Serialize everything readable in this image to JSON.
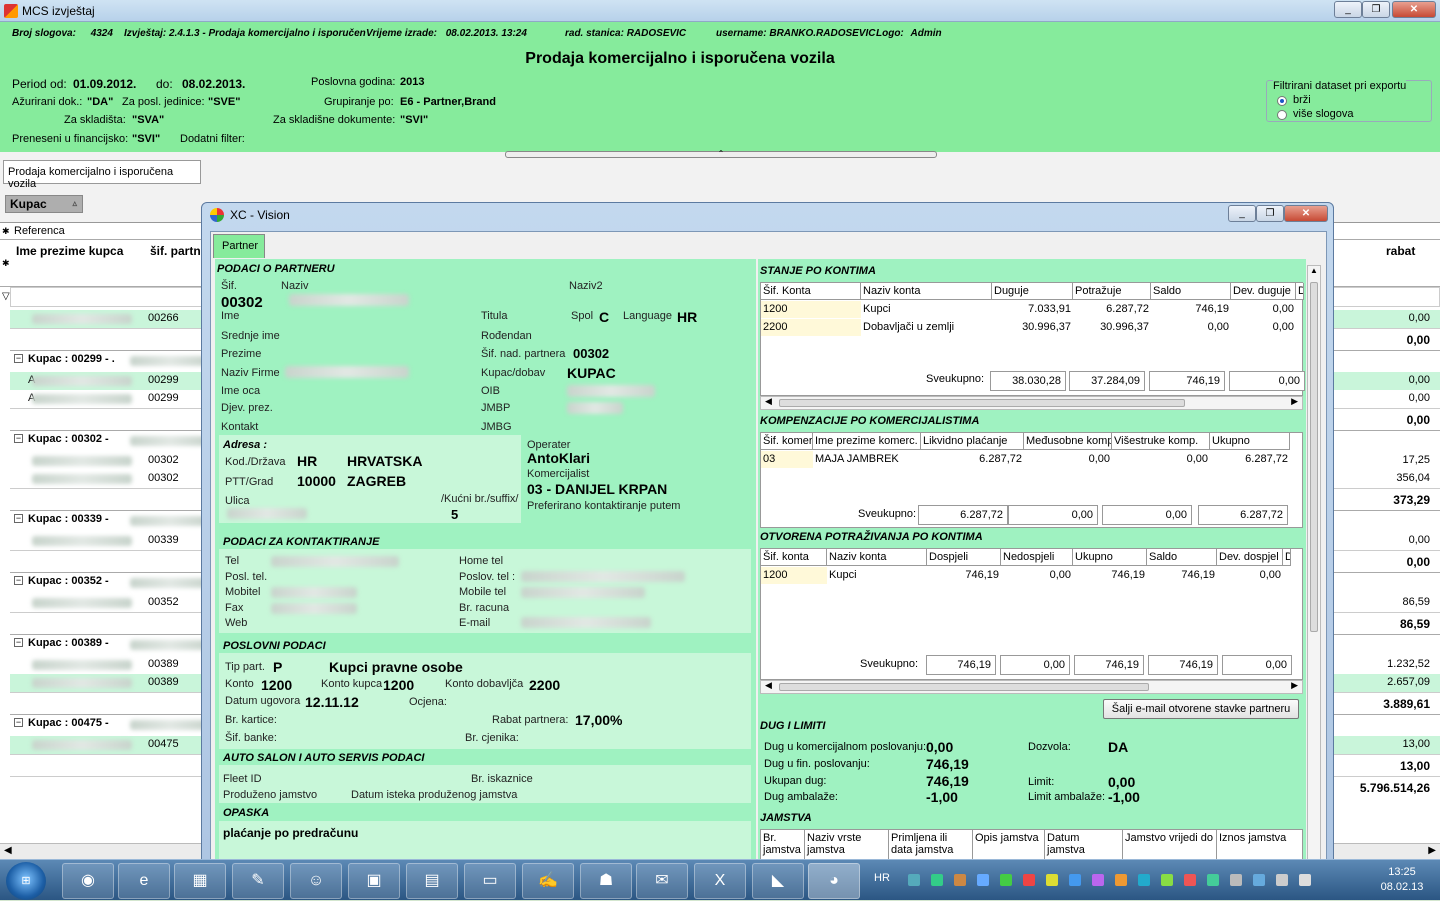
{
  "window": {
    "title": "MCS izvještaj"
  },
  "header": {
    "broj_slogova_label": "Broj slogova:",
    "broj_slogova": "4324",
    "izvjestaj_label": "Izvještaj:",
    "izvjestaj": "2.4.1.3 - Prodaja komercijalno i isporučen",
    "vrijeme_label": "Vrijeme izrade:",
    "vrijeme": "08.02.2013. 13:24",
    "stanica_label": "rad. stanica:",
    "stanica": "RADOSEVIC",
    "username_label": "username:",
    "username": "BRANKO.RADOSEVIC",
    "logo_label": "Logo:",
    "logo": "Admin",
    "report_title": "Prodaja komercijalno i isporučena vozila",
    "period_od_label": "Period od:",
    "period_od": "01.09.2012.",
    "period_do_label": "do:",
    "period_do": "08.02.2013.",
    "azurirani_label": "Ažurirani dok.:",
    "azurirani": "\"DA\"",
    "posl_jed_label": "Za posl. jedinice:",
    "posl_jed": "\"SVE\"",
    "skladista_label": "Za skladišta:",
    "skladista": "\"SVA\"",
    "preneseni_label": "Preneseni u financijsko:",
    "preneseni": "\"SVI\"",
    "dodatni_label": "Dodatni filter:",
    "godina_label": "Poslovna godina:",
    "godina": "2013",
    "grupiranje_label": "Grupiranje po:",
    "grupiranje": "E6 - Partner,Brand",
    "skl_dok_label": "Za skladišne dokumente:",
    "skl_dok": "\"SVI\"",
    "filter": {
      "legend": "Filtrirani dataset pri exportu",
      "opt1": "brži",
      "opt2": "više slogova"
    }
  },
  "report_tab": "Prodaja komercijalno i isporučena vozila",
  "group_chip": "Kupac",
  "grid": {
    "referenca": "Referenca",
    "col_ime": "Ime prezime kupca",
    "col_sif": "šif. partn",
    "col_rabat": "rabat",
    "rows": [
      {
        "type": "d",
        "sif": "00266",
        "rabat": "0,00"
      },
      {
        "type": "t",
        "rabat": "0,00"
      },
      {
        "type": "g",
        "label": "Kupac : 00299 - ."
      },
      {
        "type": "d",
        "pre": "A",
        "sif": "00299",
        "rabat": "0,00"
      },
      {
        "type": "d",
        "pre": "A",
        "sif": "00299",
        "rabat": "0,00"
      },
      {
        "type": "t",
        "rabat": "0,00"
      },
      {
        "type": "g",
        "label": "Kupac : 00302 -"
      },
      {
        "type": "d",
        "sif": "00302",
        "rabat": "17,25"
      },
      {
        "type": "d",
        "sif": "00302",
        "rabat": "356,04"
      },
      {
        "type": "t",
        "rabat": "373,29"
      },
      {
        "type": "g",
        "label": "Kupac : 00339 -"
      },
      {
        "type": "d",
        "sif": "00339",
        "rabat": "0,00"
      },
      {
        "type": "t",
        "rabat": "0,00"
      },
      {
        "type": "g",
        "label": "Kupac : 00352 -"
      },
      {
        "type": "d",
        "sif": "00352",
        "rabat": "86,59"
      },
      {
        "type": "t",
        "rabat": "86,59"
      },
      {
        "type": "g",
        "label": "Kupac : 00389 -"
      },
      {
        "type": "d",
        "sif": "00389",
        "rabat": "1.232,52"
      },
      {
        "type": "d",
        "sif": "00389",
        "rabat": "2.657,09"
      },
      {
        "type": "t",
        "rabat": "3.889,61"
      },
      {
        "type": "g",
        "label": "Kupac : 00475 -"
      },
      {
        "type": "d",
        "sif": "00475",
        "rabat": "13,00"
      },
      {
        "type": "t",
        "rabat": "13,00"
      },
      {
        "type": "t",
        "rabat": "5.796.514,26"
      }
    ]
  },
  "dialog": {
    "title": "XC - Vision",
    "tab": "Partner",
    "podaci": {
      "title": "PODACI O PARTNERU",
      "sif_label": "Šif.",
      "sif": "00302",
      "naziv_label": "Naziv",
      "naziv2_label": "Naziv2",
      "ime": "Ime",
      "titula": "Titula",
      "spol_label": "Spol",
      "spol": "C",
      "language_label": "Language",
      "language": "HR",
      "srednje": "Srednje ime",
      "rodendan": "Rođendan",
      "prezime": "Prezime",
      "sif_nad_label": "Šif. nad. partnera",
      "sif_nad": "00302",
      "naziv_firme": "Naziv Firme",
      "kupac_dobav_label": "Kupac/dobav",
      "kupac_dobav": "KUPAC",
      "ime_oca": "Ime oca",
      "oib": "OIB",
      "djev": "Djev. prez.",
      "jmbp": "JMBP",
      "kontakt": "Kontakt",
      "jmbg": "JMBG"
    },
    "adresa": {
      "title": "Adresa :",
      "kod_label": "Kod./Država",
      "kod": "HR",
      "drzava": "HRVATSKA",
      "ptt_label": "PTT/Grad",
      "ptt": "10000",
      "grad": "ZAGREB",
      "ulica": "Ulica",
      "kucni_label": "/Kućni br./suffix/",
      "kucni": "5",
      "operater_label": "Operater",
      "operater": "AntoKlari",
      "komercijalist_label": "Komercijalist",
      "komercijalist": "03 - DANIJEL KRPAN",
      "pref": "Preferirano kontaktiranje putem"
    },
    "kontakt": {
      "title": "PODACI ZA KONTAKTIRANJE",
      "tel": "Tel",
      "posl": "Posl. tel.",
      "mob": "Mobitel",
      "fax": "Fax",
      "web": "Web",
      "home": "Home tel",
      "poslov": "Poslov. tel :",
      "mobile": "Mobile tel",
      "racun": "Br. racuna",
      "email": "E-mail"
    },
    "poslovni": {
      "title": "POSLOVNI PODACI",
      "tip_label": "Tip part.",
      "tip": "P",
      "tip_naziv": "Kupci pravne osobe",
      "konto_label": "Konto",
      "konto": "1200",
      "konto_kupca_label": "Konto kupca",
      "konto_kupca": "1200",
      "konto_dob_label": "Konto dobavljča",
      "konto_dob": "2200",
      "datum_label": "Datum ugovora",
      "datum": "12.11.12",
      "ocjena": "Ocjena:",
      "kartice": "Br. kartice:",
      "rabat_label": "Rabat partnera:",
      "rabat": "17,00%",
      "banke": "Šif. banke:",
      "cjenika": "Br. cjenika:"
    },
    "auto": {
      "title": "AUTO SALON I AUTO SERVIS PODACI",
      "fleet": "Fleet ID",
      "iskaznice": "Br. iskaznice",
      "produzeno": "Produženo jamstvo",
      "datum_isteka": "Datum isteka produženog jamstva"
    },
    "opaska": {
      "title": "OPASKA",
      "text": "plaćanje po predračunu"
    },
    "stanje": {
      "title": "STANJE PO KONTIMA",
      "cols": [
        "Šif. Konta",
        "Naziv konta",
        "Duguje",
        "Potražuje",
        "Saldo",
        "Dev. duguje",
        "D"
      ],
      "rows": [
        [
          "1200",
          "Kupci",
          "7.033,91",
          "6.287,72",
          "746,19",
          "0,00"
        ],
        [
          "2200",
          "Dobavljači u zemlji",
          "30.996,37",
          "30.996,37",
          "0,00",
          "0,00"
        ]
      ],
      "sv_label": "Sveukupno:",
      "sv": [
        "38.030,28",
        "37.284,09",
        "746,19",
        "0,00"
      ]
    },
    "komp": {
      "title": "KOMPENZACIJE PO KOMERCIJALISTIMA",
      "cols": [
        "Šif. komer",
        "Ime prezime komerc.",
        "Likvidno plaćanje",
        "Međusobne komp.",
        "Višestruke komp.",
        "Ukupno"
      ],
      "rows": [
        [
          "03",
          "MAJA JAMBREK",
          "6.287,72",
          "0,00",
          "0,00",
          "6.287,72"
        ]
      ],
      "sv_label": "Sveukupno:",
      "sv": [
        "6.287,72",
        "0,00",
        "0,00",
        "6.287,72"
      ]
    },
    "otv": {
      "title": "OTVORENA POTRAŽIVANJA PO KONTIMA",
      "cols": [
        "Šif. konta",
        "Naziv konta",
        "Dospjeli",
        "Nedospjeli",
        "Ukupno",
        "Saldo",
        "Dev. dospjel",
        "D"
      ],
      "rows": [
        [
          "1200",
          "Kupci",
          "746,19",
          "0,00",
          "746,19",
          "746,19",
          "0,00"
        ]
      ],
      "sv_label": "Sveukupno:",
      "sv": [
        "746,19",
        "0,00",
        "746,19",
        "746,19",
        "0,00"
      ],
      "button": "Šalji e-mail otvorene stavke partneru"
    },
    "dug": {
      "title": "DUG I LIMITI",
      "kom_label": "Dug u komercijalnom poslovanju:",
      "kom": "0,00",
      "fin_label": "Dug u fin. poslovanju:",
      "fin": "746,19",
      "ukupan_label": "Ukupan dug:",
      "ukupan": "746,19",
      "amb_label": "Dug ambalaže:",
      "amb": "-1,00",
      "dozvola_label": "Dozvola:",
      "dozvola": "DA",
      "limit_label": "Limit:",
      "limit": "0,00",
      "limit_amb_label": "Limit ambalaže:",
      "limit_amb": "-1,00"
    },
    "jamstva": {
      "title": "JAMSTVA",
      "cols": [
        "Br. jamstva",
        "Naziv vrste jamstva",
        "Primljena ili data jamstva",
        "Opis jamstva",
        "Datum jamstva",
        "Jamstvo vrijedi do",
        "Iznos jamstva"
      ]
    }
  },
  "taskbar": {
    "lang": "HR",
    "time": "13:25",
    "date": "08.02.13"
  }
}
